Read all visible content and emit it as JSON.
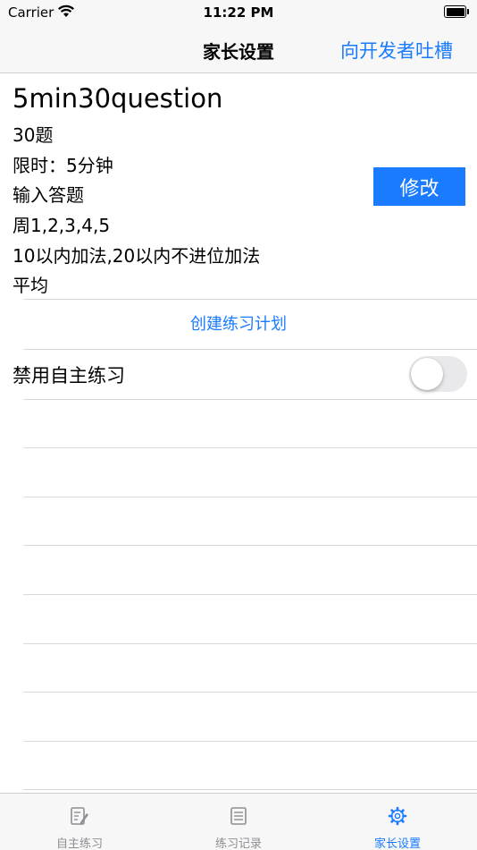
{
  "status_bar": {
    "carrier": "Carrier",
    "time": "11:22 PM"
  },
  "nav": {
    "title": "家长设置",
    "right_action": "向开发者吐槽"
  },
  "plan": {
    "name": "5min30question",
    "question_count": "30题",
    "time_limit": "限时：5分钟",
    "answer_mode": "输入答题",
    "days": "周1,2,3,4,5",
    "question_types": "10以内加法,20以内不进位加法",
    "distribution": "平均",
    "edit_label": "修改"
  },
  "create_plan_label": "创建练习计划",
  "disable_self_practice": {
    "label": "禁用自主练习",
    "enabled": false
  },
  "tabs": [
    {
      "label": "自主练习",
      "icon": "pencil-paper-icon",
      "active": false
    },
    {
      "label": "练习记录",
      "icon": "list-document-icon",
      "active": false
    },
    {
      "label": "家长设置",
      "icon": "gear-icon",
      "active": true
    }
  ],
  "colors": {
    "accent": "#1a7bff",
    "bar_background": "#f7f7f7",
    "inactive_tab": "#8e8e93"
  }
}
